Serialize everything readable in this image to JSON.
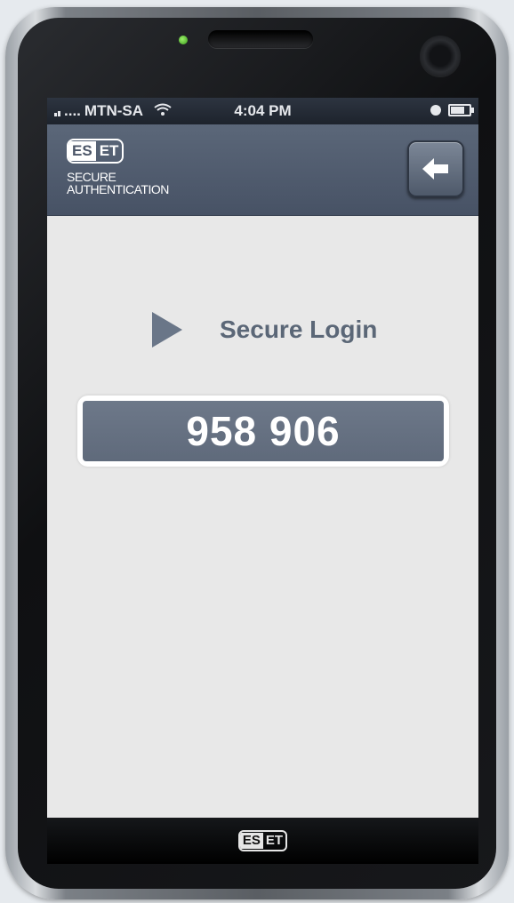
{
  "statusbar": {
    "carrier": "MTN-SA",
    "signal_prefix": "....",
    "time": "4:04 PM"
  },
  "app": {
    "logo_left": "ES",
    "logo_right": "ET",
    "brand_line1": "SECURE",
    "brand_line2": "AUTHENTICATION",
    "back_icon": "back-arrow-icon"
  },
  "main": {
    "section_label": "Secure Login",
    "otp_code": "958 906"
  },
  "footer": {
    "logo_left": "ES",
    "logo_right": "ET"
  },
  "colors": {
    "appbar": "#4f5a6c",
    "otp_background": "#66717f",
    "screen_background": "#e8e8e8"
  }
}
